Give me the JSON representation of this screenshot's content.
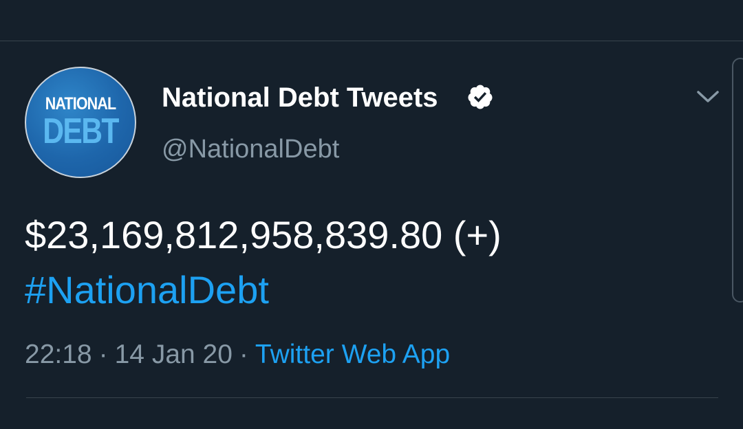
{
  "tweet": {
    "avatar": {
      "line1": "NATIONAL",
      "line2": "DEBT"
    },
    "display_name": "National Debt Tweets",
    "handle": "@NationalDebt",
    "verified": true,
    "text": "$23,169,812,958,839.80 (+)",
    "hashtag": "#NationalDebt",
    "time": "22:18",
    "date": "14 Jan 20",
    "separator": "·",
    "source": "Twitter Web App"
  },
  "colors": {
    "background": "#15202b",
    "accent": "#1da1f2",
    "secondary_text": "#8899a6",
    "divider": "#38444d"
  },
  "icons": {
    "verified": "verified-badge-icon",
    "menu": "chevron-down-icon"
  }
}
